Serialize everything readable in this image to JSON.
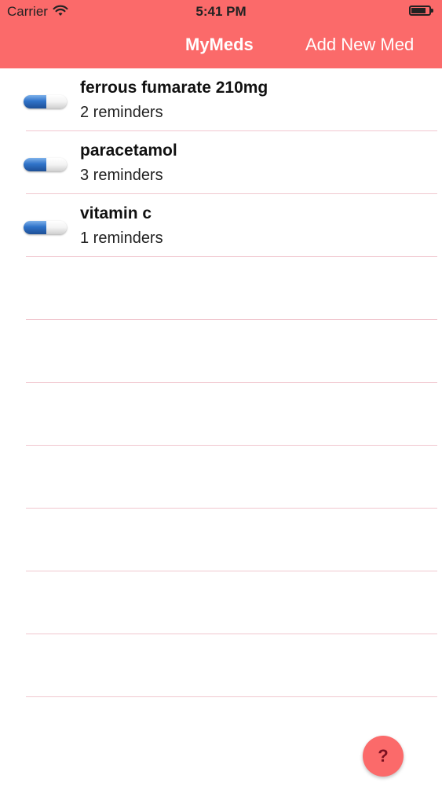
{
  "status_bar": {
    "carrier": "Carrier",
    "time": "5:41 PM"
  },
  "nav": {
    "title": "MyMeds",
    "add_label": "Add New Med"
  },
  "meds": [
    {
      "name": "ferrous fumarate 210mg",
      "reminders": "2 reminders"
    },
    {
      "name": "paracetamol",
      "reminders": "3 reminders"
    },
    {
      "name": "vitamin c",
      "reminders": "1 reminders"
    }
  ],
  "help": {
    "label": "?"
  },
  "colors": {
    "accent": "#fb6a6a",
    "separator": "#f1c7cf",
    "pill_blue": "#2f73c9"
  },
  "icons": {
    "med": "pill-icon",
    "wifi": "wifi-icon",
    "battery": "battery-icon"
  }
}
